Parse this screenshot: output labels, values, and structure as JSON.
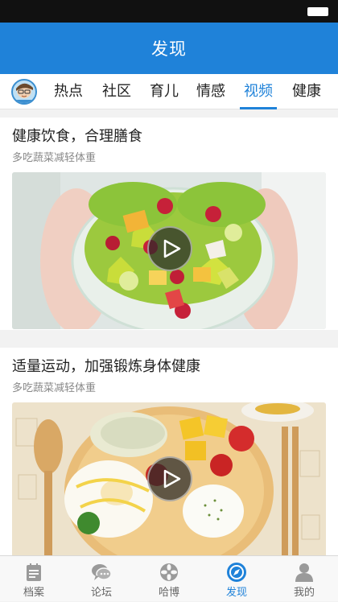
{
  "header": {
    "title": "发现"
  },
  "tabs": [
    {
      "label": "热点",
      "active": false
    },
    {
      "label": "社区",
      "active": false
    },
    {
      "label": "育儿",
      "active": false
    },
    {
      "label": "情感",
      "active": false
    },
    {
      "label": "视频",
      "active": true
    },
    {
      "label": "健康",
      "active": false
    }
  ],
  "feed": [
    {
      "title": "健康饮食，合理膳食",
      "subtitle": "多吃蔬菜减轻体重",
      "image": "fruit-salad-bowl",
      "media": "video"
    },
    {
      "title": "适量运动，加强锻炼身体健康",
      "subtitle": "多吃蔬菜减轻体重",
      "image": "breakfast-plate",
      "media": "video"
    }
  ],
  "bottom_nav": [
    {
      "label": "档案",
      "icon": "file-icon",
      "active": false
    },
    {
      "label": "论坛",
      "icon": "chat-icon",
      "active": false
    },
    {
      "label": "哈博",
      "icon": "flower-icon",
      "active": false
    },
    {
      "label": "发现",
      "icon": "compass-icon",
      "active": true
    },
    {
      "label": "我的",
      "icon": "user-icon",
      "active": false
    }
  ],
  "colors": {
    "accent": "#1f82d9",
    "status_bar": "#111111"
  }
}
